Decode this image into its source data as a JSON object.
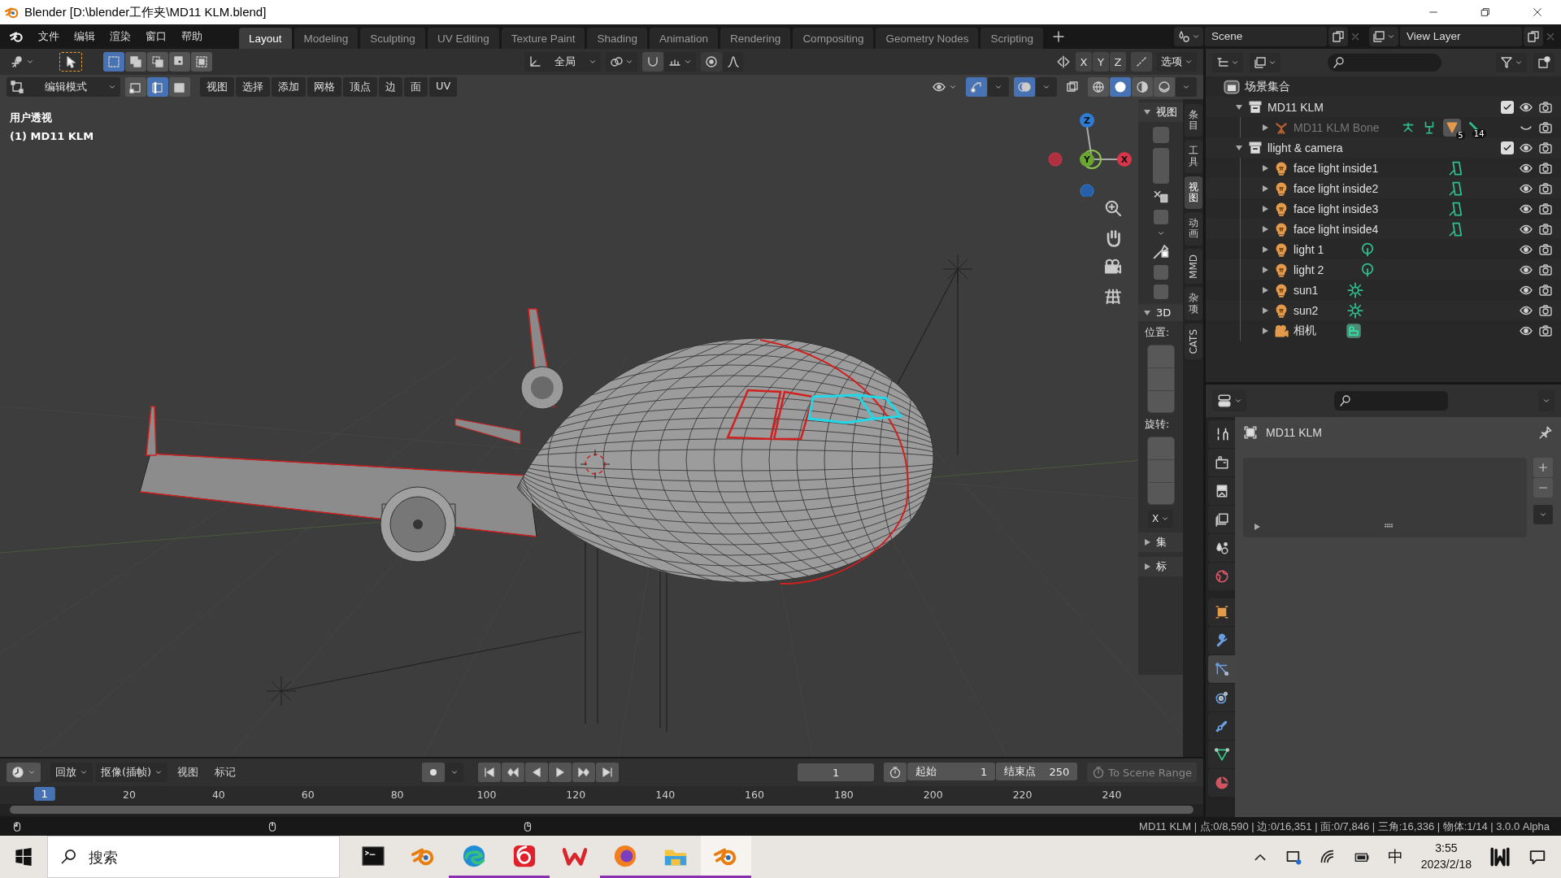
{
  "window": {
    "title": "Blender [D:\\blender工作夹\\MD11 KLM.blend]"
  },
  "menu": [
    "文件",
    "编辑",
    "渲染",
    "窗口",
    "帮助"
  ],
  "workspaces": [
    {
      "label": "Layout",
      "selected": true
    },
    {
      "label": "Modeling",
      "selected": false
    },
    {
      "label": "Sculpting",
      "selected": false
    },
    {
      "label": "UV Editing",
      "selected": false
    },
    {
      "label": "Texture Paint",
      "selected": false
    },
    {
      "label": "Shading",
      "selected": false
    },
    {
      "label": "Animation",
      "selected": false
    },
    {
      "label": "Rendering",
      "selected": false
    },
    {
      "label": "Compositing",
      "selected": false
    },
    {
      "label": "Geometry Nodes",
      "selected": false
    },
    {
      "label": "Scripting",
      "selected": false
    }
  ],
  "scene": "Scene",
  "view_layer": "View Layer",
  "viewport": {
    "box_modes": [
      {
        "selected": true
      },
      {
        "selected": false
      },
      {
        "selected": false
      },
      {
        "selected": false
      },
      {
        "selected": false
      }
    ],
    "orientation": "全局",
    "mirror_axes": [
      {
        "label": "X",
        "selected": false
      },
      {
        "label": "Y",
        "selected": false
      },
      {
        "label": "Z",
        "selected": false
      }
    ],
    "options": "选项",
    "mode": "编辑模式",
    "select_modes": [
      {
        "kind": "vertex",
        "selected": false
      },
      {
        "kind": "edge",
        "selected": true
      },
      {
        "kind": "face",
        "selected": false
      }
    ],
    "menus": [
      "视图",
      "选择",
      "添加",
      "网格",
      "顶点",
      "边",
      "面",
      "UV"
    ],
    "gizmos_on": true,
    "overlays_on": true,
    "shading": [
      {
        "kind": "wireframe",
        "selected": false
      },
      {
        "kind": "solid",
        "selected": true
      },
      {
        "kind": "material",
        "selected": false
      },
      {
        "kind": "rendered",
        "selected": false
      }
    ],
    "view_name": "用户透视",
    "object_label": "(1) MD11 KLM",
    "gizmo_axes": [
      "Z",
      "Y",
      "X"
    ],
    "sidebar": {
      "panels": [
        {
          "title": "视图",
          "expanded": true
        },
        {
          "title": "3D",
          "expanded": true
        },
        {
          "title": "集",
          "expanded": false
        },
        {
          "title": "标",
          "expanded": false
        }
      ],
      "checkboxes": [
        {
          "checked": false
        },
        {
          "checked": false
        },
        {
          "checked": false
        }
      ],
      "position_label": "位置:",
      "rotation_label": "旋转:",
      "axis": "X",
      "tabs": [
        {
          "label": "条目",
          "kind": "cjk",
          "selected": false
        },
        {
          "label": "工具",
          "kind": "cjk",
          "selected": false
        },
        {
          "label": "视图",
          "kind": "cjk",
          "selected": true
        },
        {
          "label": "动画",
          "kind": "cjk",
          "selected": false
        },
        {
          "label": "MMD",
          "kind": "latin",
          "selected": false
        },
        {
          "label": "杂项",
          "kind": "cjk",
          "selected": false
        },
        {
          "label": "CATS",
          "kind": "latin",
          "selected": false
        }
      ]
    }
  },
  "outliner": {
    "root": "场景集合",
    "collections": [
      {
        "name": "MD11 KLM",
        "expanded": true,
        "checked": true,
        "children": [
          {
            "name": "MD11 KLM Bone",
            "kind": "armature",
            "expanded": false,
            "visible": false,
            "counts": [
              "5",
              "14"
            ]
          }
        ]
      },
      {
        "name": "llight & camera",
        "expanded": true,
        "checked": true,
        "children": [
          {
            "name": "face light inside1",
            "kind": "area_light",
            "expanded": false,
            "visible": true
          },
          {
            "name": "face light inside2",
            "kind": "area_light",
            "expanded": false,
            "visible": true
          },
          {
            "name": "face light inside3",
            "kind": "area_light",
            "expanded": false,
            "visible": true
          },
          {
            "name": "face light inside4",
            "kind": "area_light",
            "expanded": false,
            "visible": true
          },
          {
            "name": "light 1",
            "kind": "point_light",
            "expanded": false,
            "visible": true
          },
          {
            "name": "light 2",
            "kind": "point_light",
            "expanded": false,
            "visible": true
          },
          {
            "name": "sun1",
            "kind": "sun_light",
            "expanded": false,
            "visible": true
          },
          {
            "name": "sun2",
            "kind": "sun_light",
            "expanded": false,
            "visible": true
          },
          {
            "name": "相机",
            "kind": "camera",
            "expanded": false,
            "visible": true
          }
        ]
      }
    ]
  },
  "properties": {
    "object": "MD11 KLM",
    "tabs": [
      {
        "kind": "tool",
        "selected": false
      },
      {
        "kind": "render",
        "selected": false
      },
      {
        "kind": "output",
        "selected": false
      },
      {
        "kind": "view_layer",
        "selected": false
      },
      {
        "kind": "scene",
        "selected": false
      },
      {
        "kind": "world",
        "selected": false
      },
      {
        "kind": "object",
        "selected": false
      },
      {
        "kind": "modifier",
        "selected": false
      },
      {
        "kind": "particles",
        "selected": true
      },
      {
        "kind": "physics",
        "selected": false
      },
      {
        "kind": "constraints",
        "selected": false
      },
      {
        "kind": "data",
        "selected": false
      },
      {
        "kind": "material",
        "selected": false
      }
    ]
  },
  "timeline": {
    "playback": "回放",
    "keying": "抠像(插帧)",
    "menus": [
      "视图",
      "标记"
    ],
    "current_frame": "1",
    "start_label": "起始",
    "start": "1",
    "end_label": "结束点",
    "end": "250",
    "scene_range": "To Scene Range",
    "playhead": "1",
    "ruler": [
      "20",
      "40",
      "60",
      "80",
      "100",
      "120",
      "140",
      "160",
      "180",
      "200",
      "220",
      "240"
    ]
  },
  "status_bar": {
    "text": "MD11 KLM | 点:0/8,590 | 边:0/16,351 | 面:0/7,846 | 三角:16,336 | 物体:1/14 | 3.0.0 Alpha"
  },
  "taskbar": {
    "search_placeholder": "搜索",
    "apps": [
      {
        "kind": "terminal",
        "running": false,
        "selected": false
      },
      {
        "kind": "blender",
        "running": false,
        "selected": false
      },
      {
        "kind": "edge",
        "running": true,
        "selected": false
      },
      {
        "kind": "netease",
        "running": true,
        "selected": false
      },
      {
        "kind": "wps",
        "running": false,
        "selected": false
      },
      {
        "kind": "firefox",
        "running": true,
        "selected": false
      },
      {
        "kind": "explorer",
        "running": true,
        "selected": false
      },
      {
        "kind": "blender",
        "running": true,
        "selected": true
      }
    ],
    "ime": "中",
    "time": "3:55",
    "date": "2023/2/18"
  }
}
